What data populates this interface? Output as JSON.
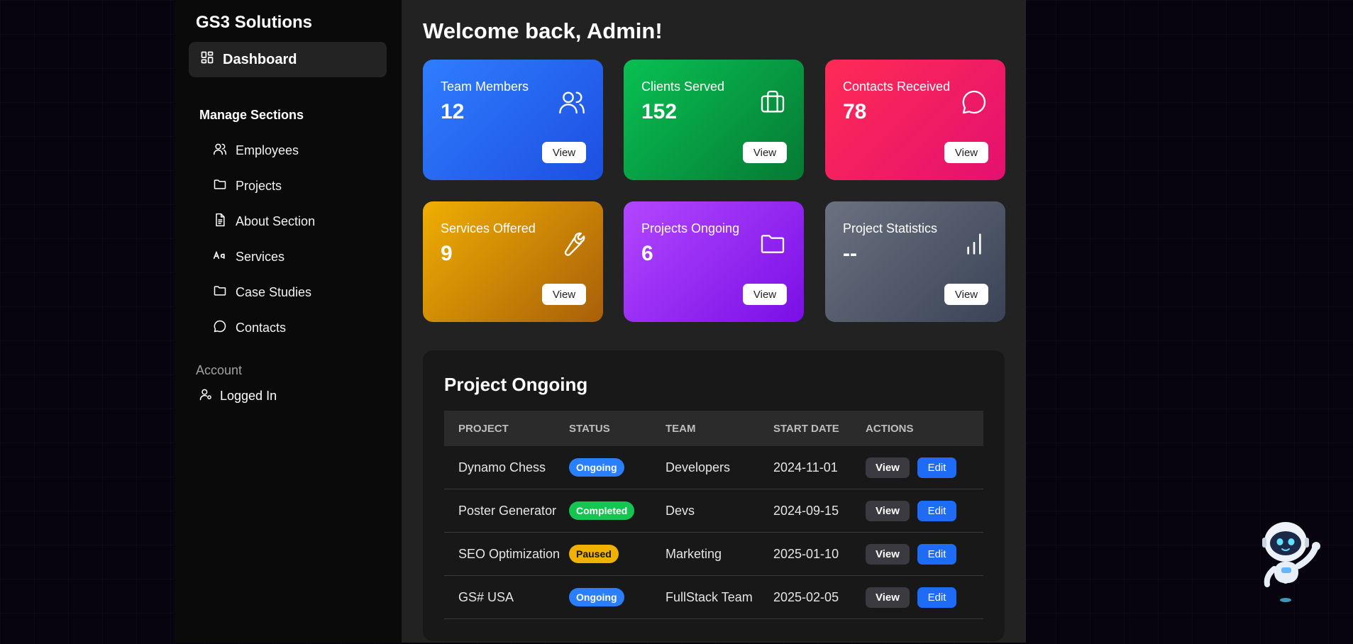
{
  "sidebar": {
    "brand": "GS3 Solutions",
    "dashboard_label": "Dashboard",
    "manage_heading": "Manage Sections",
    "items": [
      {
        "label": "Employees",
        "icon": "users-icon"
      },
      {
        "label": "Projects",
        "icon": "folder-icon"
      },
      {
        "label": "About Section",
        "icon": "document-icon"
      },
      {
        "label": "Services",
        "icon": "text-icon"
      },
      {
        "label": "Case Studies",
        "icon": "folder-icon"
      },
      {
        "label": "Contacts",
        "icon": "chat-icon"
      }
    ],
    "account_heading": "Account",
    "logged_in_label": "Logged In"
  },
  "main": {
    "welcome": "Welcome back, Admin!",
    "cards": [
      {
        "title": "Team Members",
        "value": "12",
        "view": "View",
        "icon": "users-icon",
        "color": "#2f7dff"
      },
      {
        "title": "Clients Served",
        "value": "152",
        "view": "View",
        "icon": "briefcase-icon",
        "color": "#08c052"
      },
      {
        "title": "Contacts Received",
        "value": "78",
        "view": "View",
        "icon": "chat-icon",
        "color": "#ff2b55"
      },
      {
        "title": "Services Offered",
        "value": "9",
        "view": "View",
        "icon": "wrench-icon",
        "color": "#f0ae02"
      },
      {
        "title": "Projects Ongoing",
        "value": "6",
        "view": "View",
        "icon": "folder-icon",
        "color": "#b247ff"
      },
      {
        "title": "Project Statistics",
        "value": "--",
        "view": "View",
        "icon": "bar-chart-icon",
        "color": "#6b7180"
      }
    ],
    "projects": {
      "title": "Project Ongoing",
      "columns": [
        "PROJECT",
        "STATUS",
        "TEAM",
        "START DATE",
        "ACTIONS"
      ],
      "rows": [
        {
          "project": "Dynamo Chess",
          "status": "Ongoing",
          "team": "Developers",
          "start": "2024-11-01",
          "view": "View",
          "edit": "Edit"
        },
        {
          "project": "Poster Generator",
          "status": "Completed",
          "team": "Devs",
          "start": "2024-09-15",
          "view": "View",
          "edit": "Edit"
        },
        {
          "project": "SEO Optimization",
          "status": "Paused",
          "team": "Marketing",
          "start": "2025-01-10",
          "view": "View",
          "edit": "Edit"
        },
        {
          "project": "GS# USA",
          "status": "Ongoing",
          "team": "FullStack Team",
          "start": "2025-02-05",
          "view": "View",
          "edit": "Edit"
        }
      ]
    }
  }
}
